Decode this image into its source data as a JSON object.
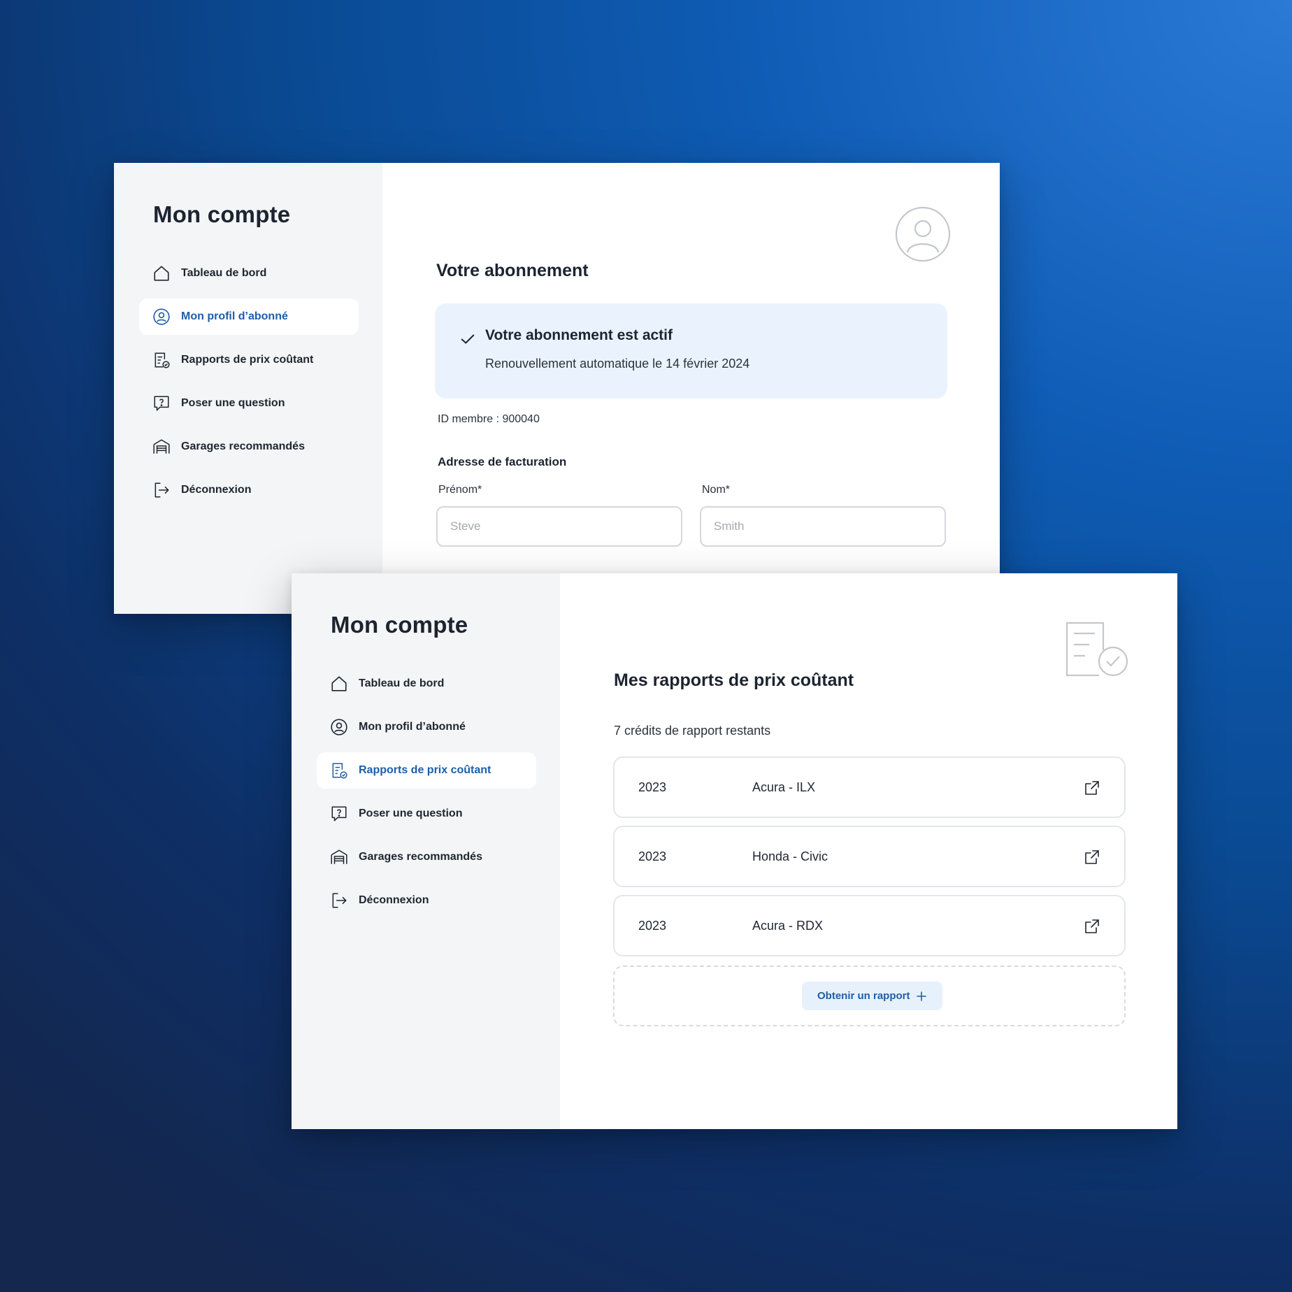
{
  "colors": {
    "accent": "#1e5ea8",
    "sidebar_bg": "#f3f5f7",
    "status_bg": "#eaf3fd",
    "icon_stroke": "#1f2630",
    "muted_icon": "#c2c7cd"
  },
  "sidebar": {
    "title": "Mon compte",
    "items": [
      {
        "label": "Tableau de bord",
        "icon": "home-icon"
      },
      {
        "label": "Mon profil d’abonné",
        "icon": "user-circle-icon"
      },
      {
        "label": "Rapports de prix coûtant",
        "icon": "report-check-icon"
      },
      {
        "label": "Poser une question",
        "icon": "question-bubble-icon"
      },
      {
        "label": "Garages recommandés",
        "icon": "garage-icon"
      },
      {
        "label": "Déconnexion",
        "icon": "logout-icon"
      }
    ]
  },
  "profile_screen": {
    "active_item": "Mon profil d’abonné",
    "heading": "Votre abonnement",
    "header_icon": "avatar-icon",
    "status": {
      "icon": "check-icon",
      "title": "Votre abonnement est actif",
      "subtitle": "Renouvellement automatique le 14 février 2024"
    },
    "member_id": "ID membre : 900040",
    "billing": {
      "title": "Adresse de facturation",
      "first_name_label": "Prénom*",
      "first_name_placeholder": "Steve",
      "last_name_label": "Nom*",
      "last_name_placeholder": "Smith"
    }
  },
  "reports_screen": {
    "active_item": "Rapports de prix coûtant",
    "heading": "Mes rapports de prix coûtant",
    "header_icon": "document-check-icon",
    "credits": "7 crédits de rapport restants",
    "reports": [
      {
        "year": "2023",
        "model": "Acura - ILX"
      },
      {
        "year": "2023",
        "model": "Honda - Civic"
      },
      {
        "year": "2023",
        "model": "Acura - RDX"
      }
    ],
    "add_button": "Obtenir un rapport"
  }
}
